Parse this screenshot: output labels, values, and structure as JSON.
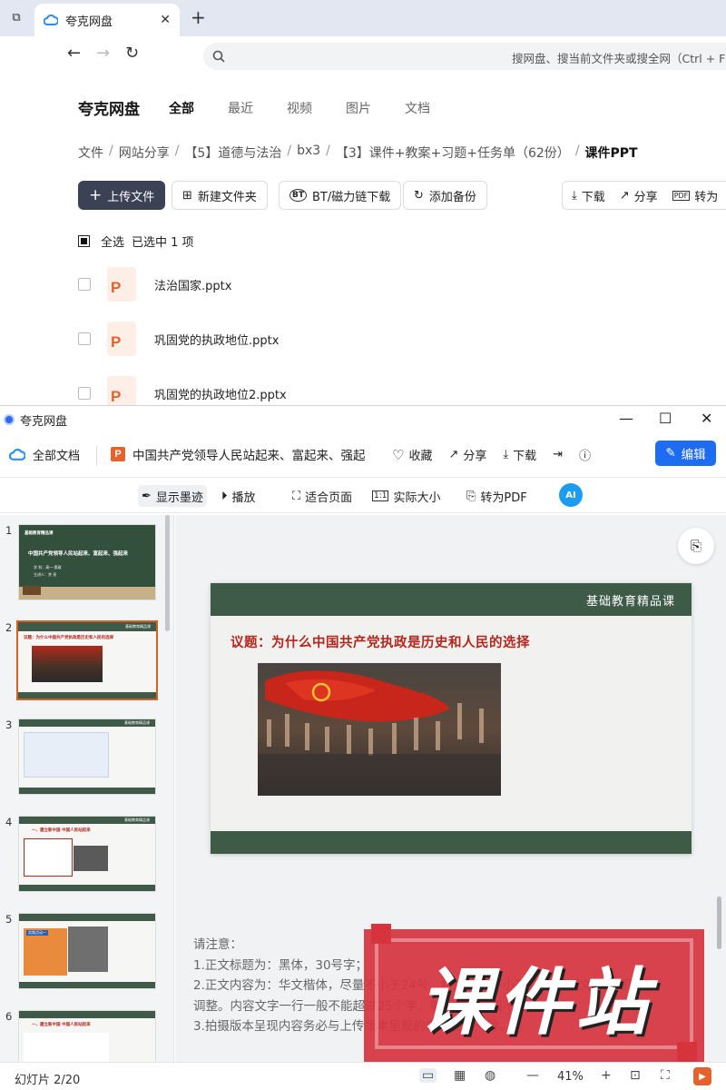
{
  "browser": {
    "tab_title": "夸克网盘",
    "search_placeholder": "搜网盘、搜当前文件夹或搜全网（Ctrl + F"
  },
  "drive": {
    "brand": "夸克网盘",
    "topnav": [
      "全部",
      "最近",
      "视频",
      "图片",
      "文档"
    ],
    "breadcrumb": [
      "文件",
      "网站分享",
      "【5】道德与法治",
      "bx3",
      "【3】课件+教案+习题+任务单（62份）",
      "课件PPT"
    ],
    "toolbar": {
      "upload": "上传文件",
      "new_folder": "新建文件夹",
      "bt_download": "BT/磁力链下载",
      "add_backup": "添加备份",
      "download": "下载",
      "share": "分享",
      "convert": "转为"
    },
    "select_all": "全选",
    "selected_text": "已选中 1 项",
    "files": [
      "法治国家.pptx",
      "巩固党的执政地位.pptx",
      "巩固党的执政地位2.pptx"
    ]
  },
  "viewer": {
    "window_title": "夸克网盘",
    "all_docs": "全部文档",
    "doc_title": "中国共产党领导人民站起来、富起来、强起",
    "actions": {
      "favorite": "收藏",
      "share": "分享",
      "download": "下载",
      "edit": "编辑"
    },
    "tools": {
      "ink": "显示墨迹",
      "play": "播放",
      "fit": "适合页面",
      "actual": "实际大小",
      "to_pdf": "转为PDF",
      "ai": "AI"
    },
    "thumbnails": [
      {
        "num": "1",
        "lines": [
          "基础教育精品课",
          "中国共产党领导人民站起来、富起来、强起来",
          "学 科：高一·思政",
          "主讲人：余 亮"
        ]
      },
      {
        "num": "2",
        "lines": [
          "基础教育精品课",
          "议题：为什么中国共产党执政是历史和人民的选择"
        ]
      },
      {
        "num": "3",
        "lines": [
          "基础教育精品课"
        ]
      },
      {
        "num": "4",
        "lines": [
          "基础教育精品课",
          "一、建立新中国 中国人民站起来"
        ]
      },
      {
        "num": "5",
        "lines": [
          "基础教育精品课",
          "实践活动一"
        ]
      },
      {
        "num": "6",
        "lines": [
          "基础教育精品课",
          "一、建立新中国 中国人民站起来"
        ]
      }
    ],
    "slide": {
      "header_tag": "基础教育精品课",
      "title": "议题：为什么中国共产党执政是历史和人民的选择"
    },
    "notes": [
      "请注意：",
      "1.正文标题为：黑体，30号字；",
      "2.正文内容为：华文楷体，尽量不小于24号，特殊情况不小于18，根据文字量可酌当",
      "调整。内容文字一行一般不能超过25个字，单页文字一般不超过15行；",
      "3.拍摄版本呈现内容务必与上传版本呈现的内容完全一致。"
    ],
    "watermark": "课件站",
    "status": {
      "page": "幻灯片 2/20",
      "zoom": "41%"
    }
  }
}
